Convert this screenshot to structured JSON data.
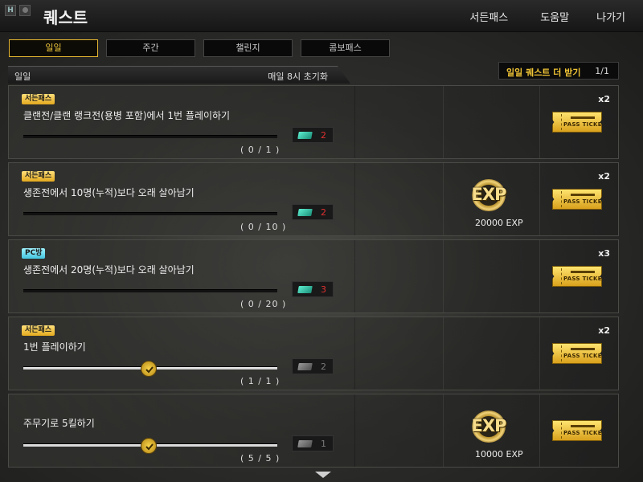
{
  "header": {
    "title": "퀘스트",
    "win_icons": [
      "H",
      ""
    ],
    "nav": [
      "서든패스",
      "도움말",
      "나가기"
    ]
  },
  "tabs": [
    {
      "label": "일일",
      "active": true
    },
    {
      "label": "주간",
      "active": false
    },
    {
      "label": "챌린지",
      "active": false
    },
    {
      "label": "콤보패스",
      "active": false
    }
  ],
  "section": {
    "label": "일일",
    "reset": "매일 8시 초기화"
  },
  "more_quest": {
    "label": "일일 퀘스트 더 받기",
    "count": "1/1"
  },
  "quests": [
    {
      "badge": "서든패스",
      "badge_color": "#f0c035",
      "title": "클랜전/클랜 랭크전(용병 포함)에서 1번 플레이하기",
      "progress_text": "( 0 / 1 )",
      "progress": 0,
      "ticket_count": "2",
      "exp": null,
      "multiplier": "x2",
      "pass_label": "PASS TICKET"
    },
    {
      "badge": "서든패스",
      "badge_color": "#f0c035",
      "title": "생존전에서 10명(누적)보다 오래 살아남기",
      "progress_text": "( 0 / 10 )",
      "progress": 0,
      "ticket_count": "2",
      "exp": "20000 EXP",
      "exp_label": "EXP",
      "multiplier": "x2",
      "pass_label": "PASS TICKET"
    },
    {
      "badge": "PC방",
      "badge_color": "#5fd5ea",
      "title": "생존전에서 20명(누적)보다 오래 살아남기",
      "progress_text": "( 0 / 20 )",
      "progress": 0,
      "ticket_count": "3",
      "exp": null,
      "multiplier": "x3",
      "pass_label": "PASS TICKET"
    },
    {
      "badge": "서든패스",
      "badge_color": "#f0c035",
      "title": "1번 플레이하기",
      "progress_text": "( 1 / 1 )",
      "progress": 1.0,
      "ticket_count": "2",
      "exp": null,
      "multiplier": "x2",
      "pass_label": "PASS TICKET"
    },
    {
      "badge": null,
      "title": "주무기로 5킬하기",
      "progress_text": "( 5 / 5 )",
      "progress": 1.0,
      "ticket_count": "1",
      "exp": "10000 EXP",
      "exp_label": "EXP",
      "multiplier": null,
      "pass_label": "PASS TICKET"
    }
  ]
}
